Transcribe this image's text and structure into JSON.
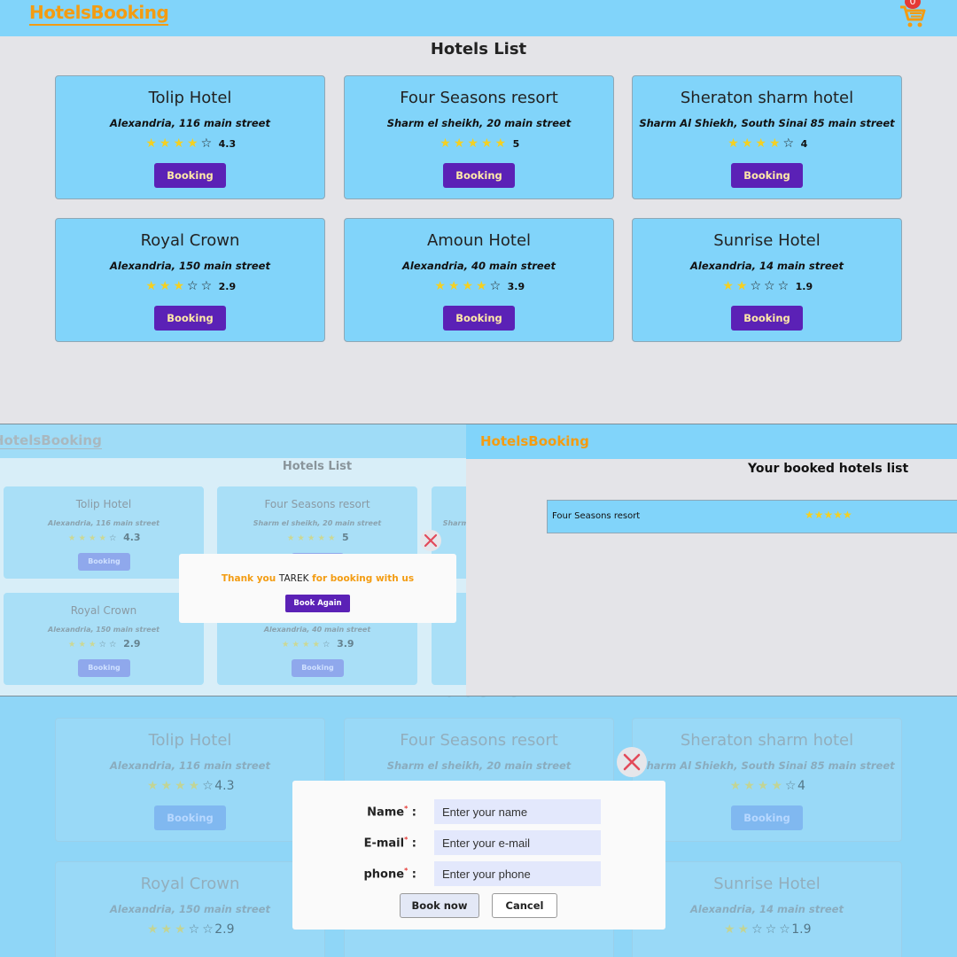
{
  "app": {
    "brand": "HotelsBooking",
    "cart_count": "0",
    "page_title": "Hotels List"
  },
  "colors": {
    "header": "#81d4fa",
    "brand": "#f39c12",
    "booking_button": "#5b21b6",
    "star": "#f5d020"
  },
  "hotels": [
    {
      "name": "Tolip Hotel",
      "address": "Alexandria, 116 main street",
      "rating": "4.3",
      "stars_full": 4,
      "button": "Booking"
    },
    {
      "name": "Four Seasons resort",
      "address": "Sharm el sheikh, 20 main street",
      "rating": "5",
      "stars_full": 5,
      "button": "Booking"
    },
    {
      "name": "Sheraton sharm hotel",
      "address": "Sharm Al Shiekh, South Sinai 85 main street",
      "rating": "4",
      "stars_full": 4,
      "button": "Booking"
    },
    {
      "name": "Royal Crown",
      "address": "Alexandria, 150 main street",
      "rating": "2.9",
      "stars_full": 3,
      "button": "Booking"
    },
    {
      "name": "Amoun Hotel",
      "address": "Alexandria, 40 main street",
      "rating": "3.9",
      "stars_full": 4,
      "button": "Booking"
    },
    {
      "name": "Sunrise Hotel",
      "address": "Alexandria, 14 main street",
      "rating": "1.9",
      "stars_full": 2,
      "button": "Booking"
    }
  ],
  "thanks_modal": {
    "prefix": "Thank you",
    "user": "TAREK",
    "suffix": "for booking with us",
    "button": "Book Again"
  },
  "booked_list": {
    "title": "Your booked hotels list",
    "items": [
      {
        "name": "Four Seasons resort",
        "stars": "★★★★★"
      }
    ]
  },
  "booking_form": {
    "name_label": "Name",
    "email_label": "E-mail",
    "phone_label": "phone",
    "required_mark": "*",
    "colon": ":",
    "name_placeholder": "Enter your name",
    "email_placeholder": "Enter your e-mail",
    "phone_placeholder": "Enter your phone",
    "submit": "Book now",
    "cancel": "Cancel"
  },
  "icons": {
    "cart": "shopping-cart-icon",
    "close": "close-icon",
    "star_full": "★",
    "star_empty": "☆"
  }
}
